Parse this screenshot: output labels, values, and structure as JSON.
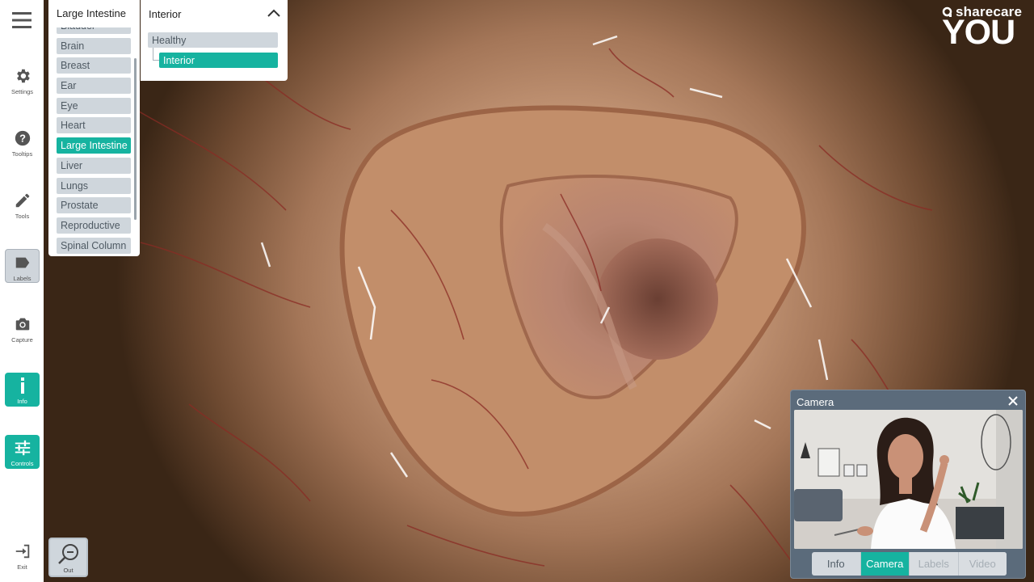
{
  "sidebar": {
    "items": [
      {
        "label": "Settings",
        "icon": "gear-icon"
      },
      {
        "label": "Tooltips",
        "icon": "question-circle-icon"
      },
      {
        "label": "Tools",
        "icon": "pencil-icon"
      },
      {
        "label": "Labels",
        "icon": "label-tag-icon"
      },
      {
        "label": "Capture",
        "icon": "camera-icon"
      },
      {
        "label": "Info",
        "icon": "info-icon"
      },
      {
        "label": "Controls",
        "icon": "sliders-icon"
      },
      {
        "label": "Exit",
        "icon": "exit-icon"
      }
    ]
  },
  "organ_menu": {
    "title": "Large Intestine",
    "items": [
      "Bladder",
      "Brain",
      "Breast",
      "Ear",
      "Eye",
      "Heart",
      "Large Intestine",
      "Liver",
      "Lungs",
      "Prostate",
      "Reproductive",
      "Spinal Column"
    ],
    "selected": "Large Intestine"
  },
  "view_menu": {
    "title": "Interior",
    "items": [
      "Healthy",
      "Interior"
    ],
    "selected": "Interior"
  },
  "logo": {
    "brand": "sharecare",
    "product": "YOU"
  },
  "camera_panel": {
    "title": "Camera",
    "tabs": [
      "Info",
      "Camera",
      "Labels",
      "Video"
    ],
    "selected_tab": "Camera"
  },
  "zoom": {
    "label": "Out"
  },
  "colors": {
    "accent": "#16b3a0",
    "panel": "#5b6b7b",
    "button_grey": "#cfd6dc"
  }
}
